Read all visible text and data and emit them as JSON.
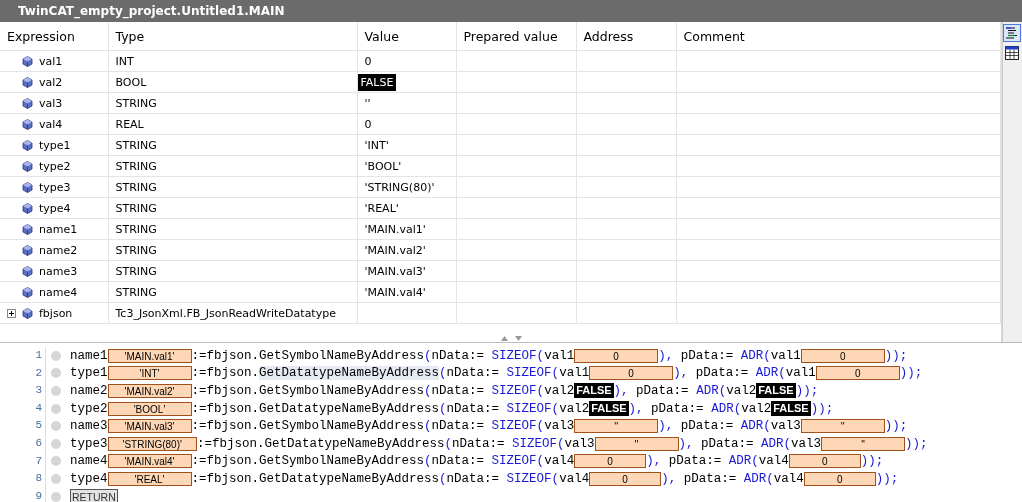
{
  "window": {
    "title": "TwinCAT_empty_project.Untitled1.MAIN"
  },
  "table": {
    "columns": [
      "Expression",
      "Type",
      "Value",
      "Prepared value",
      "Address",
      "Comment"
    ],
    "rows": [
      {
        "expression": "val1",
        "type": "INT",
        "value": "0",
        "kind": "plain"
      },
      {
        "expression": "val2",
        "type": "BOOL",
        "value": "FALSE",
        "kind": "bool"
      },
      {
        "expression": "val3",
        "type": "STRING",
        "value": "''",
        "kind": "plain"
      },
      {
        "expression": "val4",
        "type": "REAL",
        "value": "0",
        "kind": "plain"
      },
      {
        "expression": "type1",
        "type": "STRING",
        "value": "'INT'",
        "kind": "plain"
      },
      {
        "expression": "type2",
        "type": "STRING",
        "value": "'BOOL'",
        "kind": "plain"
      },
      {
        "expression": "type3",
        "type": "STRING",
        "value": "'STRING(80)'",
        "kind": "plain"
      },
      {
        "expression": "type4",
        "type": "STRING",
        "value": "'REAL'",
        "kind": "plain"
      },
      {
        "expression": "name1",
        "type": "STRING",
        "value": "'MAIN.val1'",
        "kind": "plain"
      },
      {
        "expression": "name2",
        "type": "STRING",
        "value": "'MAIN.val2'",
        "kind": "plain"
      },
      {
        "expression": "name3",
        "type": "STRING",
        "value": "'MAIN.val3'",
        "kind": "plain"
      },
      {
        "expression": "name4",
        "type": "STRING",
        "value": "'MAIN.val4'",
        "kind": "plain"
      },
      {
        "expression": "fbjson",
        "type": "Tc3_JsonXml.FB_JsonReadWriteDatatype",
        "value": "",
        "kind": "block",
        "expanded": false
      }
    ]
  },
  "view_buttons": [
    {
      "kind": "text",
      "selected": true
    },
    {
      "kind": "table",
      "selected": false
    }
  ],
  "editor": {
    "lines": [
      {
        "number": "1",
        "tokens": [
          {
            "kind": "id",
            "text": "name1"
          },
          {
            "kind": "val",
            "text": "'MAIN.val1'"
          },
          {
            "kind": "id",
            "text": ":=fbjson.GetSymbolNameByAddress"
          },
          {
            "kind": "p",
            "text": "("
          },
          {
            "kind": "id",
            "text": "nData:="
          },
          {
            "kind": "kw",
            "text": " SIZEOF"
          },
          {
            "kind": "p",
            "text": "("
          },
          {
            "kind": "id",
            "text": "val1"
          },
          {
            "kind": "val",
            "text": "0"
          },
          {
            "kind": "p",
            "text": "), "
          },
          {
            "kind": "id",
            "text": "pData:="
          },
          {
            "kind": "kw",
            "text": " ADR"
          },
          {
            "kind": "p",
            "text": "("
          },
          {
            "kind": "id",
            "text": "val1"
          },
          {
            "kind": "val",
            "text": "0"
          },
          {
            "kind": "p",
            "text": "));"
          }
        ]
      },
      {
        "number": "2",
        "tokens": [
          {
            "kind": "id",
            "text": "type1"
          },
          {
            "kind": "val",
            "text": "'INT'"
          },
          {
            "kind": "id",
            "text": ":=fbjson."
          },
          {
            "kind": "hl",
            "text": "GetDatatypeNameByAddress"
          },
          {
            "kind": "p",
            "text": "("
          },
          {
            "kind": "id",
            "text": "nData:="
          },
          {
            "kind": "kw",
            "text": " SIZEOF"
          },
          {
            "kind": "p",
            "text": "("
          },
          {
            "kind": "id",
            "text": "val1"
          },
          {
            "kind": "val",
            "text": "0"
          },
          {
            "kind": "p",
            "text": "), "
          },
          {
            "kind": "id",
            "text": "pData:="
          },
          {
            "kind": "kw",
            "text": " ADR"
          },
          {
            "kind": "p",
            "text": "("
          },
          {
            "kind": "id",
            "text": "val1"
          },
          {
            "kind": "val",
            "text": "0"
          },
          {
            "kind": "p",
            "text": "));"
          }
        ]
      },
      {
        "number": "3",
        "tokens": [
          {
            "kind": "id",
            "text": "name2"
          },
          {
            "kind": "val",
            "text": "'MAIN.val2'"
          },
          {
            "kind": "id",
            "text": ":=fbjson.GetSymbolNameByAddress"
          },
          {
            "kind": "p",
            "text": "("
          },
          {
            "kind": "id",
            "text": "nData:="
          },
          {
            "kind": "kw",
            "text": " SIZEOF"
          },
          {
            "kind": "p",
            "text": "("
          },
          {
            "kind": "id",
            "text": "val2"
          },
          {
            "kind": "bool",
            "text": "FALSE"
          },
          {
            "kind": "p",
            "text": "), "
          },
          {
            "kind": "id",
            "text": "pData:="
          },
          {
            "kind": "kw",
            "text": " ADR"
          },
          {
            "kind": "p",
            "text": "("
          },
          {
            "kind": "id",
            "text": "val2"
          },
          {
            "kind": "bool",
            "text": "FALSE"
          },
          {
            "kind": "p",
            "text": "));"
          }
        ]
      },
      {
        "number": "4",
        "tokens": [
          {
            "kind": "id",
            "text": "type2"
          },
          {
            "kind": "val",
            "text": "'BOOL'"
          },
          {
            "kind": "id",
            "text": ":=fbjson.GetDatatypeNameByAddress"
          },
          {
            "kind": "p",
            "text": "("
          },
          {
            "kind": "id",
            "text": "nData:="
          },
          {
            "kind": "kw",
            "text": " SIZEOF"
          },
          {
            "kind": "p",
            "text": "("
          },
          {
            "kind": "id",
            "text": "val2"
          },
          {
            "kind": "bool",
            "text": "FALSE"
          },
          {
            "kind": "p",
            "text": "), "
          },
          {
            "kind": "id",
            "text": "pData:="
          },
          {
            "kind": "kw",
            "text": " ADR"
          },
          {
            "kind": "p",
            "text": "("
          },
          {
            "kind": "id",
            "text": "val2"
          },
          {
            "kind": "bool",
            "text": "FALSE"
          },
          {
            "kind": "p",
            "text": "));"
          }
        ]
      },
      {
        "number": "5",
        "tokens": [
          {
            "kind": "id",
            "text": "name3"
          },
          {
            "kind": "val",
            "text": "'MAIN.val3'"
          },
          {
            "kind": "id",
            "text": ":=fbjson.GetSymbolNameByAddress"
          },
          {
            "kind": "p",
            "text": "("
          },
          {
            "kind": "id",
            "text": "nData:="
          },
          {
            "kind": "kw",
            "text": " SIZEOF"
          },
          {
            "kind": "p",
            "text": "("
          },
          {
            "kind": "id",
            "text": "val3"
          },
          {
            "kind": "wide",
            "text": "''"
          },
          {
            "kind": "p",
            "text": "), "
          },
          {
            "kind": "id",
            "text": "pData:="
          },
          {
            "kind": "kw",
            "text": " ADR"
          },
          {
            "kind": "p",
            "text": "("
          },
          {
            "kind": "id",
            "text": "val3"
          },
          {
            "kind": "wide",
            "text": "''"
          },
          {
            "kind": "p",
            "text": "));"
          }
        ]
      },
      {
        "number": "6",
        "tokens": [
          {
            "kind": "id",
            "text": "type3"
          },
          {
            "kind": "val",
            "text": "'STRING(80)'"
          },
          {
            "kind": "id",
            "text": ":=fbjson.GetDatatypeNameByAddress"
          },
          {
            "kind": "p",
            "text": "("
          },
          {
            "kind": "id",
            "text": "nData:="
          },
          {
            "kind": "kw",
            "text": " SIZEOF"
          },
          {
            "kind": "p",
            "text": "("
          },
          {
            "kind": "id",
            "text": "val3"
          },
          {
            "kind": "wide",
            "text": "''"
          },
          {
            "kind": "p",
            "text": "), "
          },
          {
            "kind": "id",
            "text": "pData:="
          },
          {
            "kind": "kw",
            "text": " ADR"
          },
          {
            "kind": "p",
            "text": "("
          },
          {
            "kind": "id",
            "text": "val3"
          },
          {
            "kind": "wide",
            "text": "''"
          },
          {
            "kind": "p",
            "text": "));"
          }
        ]
      },
      {
        "number": "7",
        "tokens": [
          {
            "kind": "id",
            "text": "name4"
          },
          {
            "kind": "val",
            "text": "'MAIN.val4'"
          },
          {
            "kind": "id",
            "text": ":=fbjson.GetSymbolNameByAddress"
          },
          {
            "kind": "p",
            "text": "("
          },
          {
            "kind": "id",
            "text": "nData:="
          },
          {
            "kind": "kw",
            "text": " SIZEOF"
          },
          {
            "kind": "p",
            "text": "("
          },
          {
            "kind": "id",
            "text": "val4"
          },
          {
            "kind": "mid",
            "text": "0"
          },
          {
            "kind": "p",
            "text": "), "
          },
          {
            "kind": "id",
            "text": "pData:="
          },
          {
            "kind": "kw",
            "text": " ADR"
          },
          {
            "kind": "p",
            "text": "("
          },
          {
            "kind": "id",
            "text": "val4"
          },
          {
            "kind": "mid",
            "text": "0"
          },
          {
            "kind": "p",
            "text": "));"
          }
        ]
      },
      {
        "number": "8",
        "tokens": [
          {
            "kind": "id",
            "text": "type4"
          },
          {
            "kind": "val",
            "text": "'REAL'"
          },
          {
            "kind": "id",
            "text": ":=fbjson.GetDatatypeNameByAddress"
          },
          {
            "kind": "p",
            "text": "("
          },
          {
            "kind": "id",
            "text": "nData:="
          },
          {
            "kind": "kw",
            "text": " SIZEOF"
          },
          {
            "kind": "p",
            "text": "("
          },
          {
            "kind": "id",
            "text": "val4"
          },
          {
            "kind": "mid",
            "text": "0"
          },
          {
            "kind": "p",
            "text": "), "
          },
          {
            "kind": "id",
            "text": "pData:="
          },
          {
            "kind": "kw",
            "text": " ADR"
          },
          {
            "kind": "p",
            "text": "("
          },
          {
            "kind": "id",
            "text": "val4"
          },
          {
            "kind": "mid",
            "text": "0"
          },
          {
            "kind": "p",
            "text": "));"
          }
        ]
      },
      {
        "number": "9",
        "tokens": [
          {
            "kind": "ret",
            "text": "RETURN"
          }
        ]
      }
    ]
  }
}
